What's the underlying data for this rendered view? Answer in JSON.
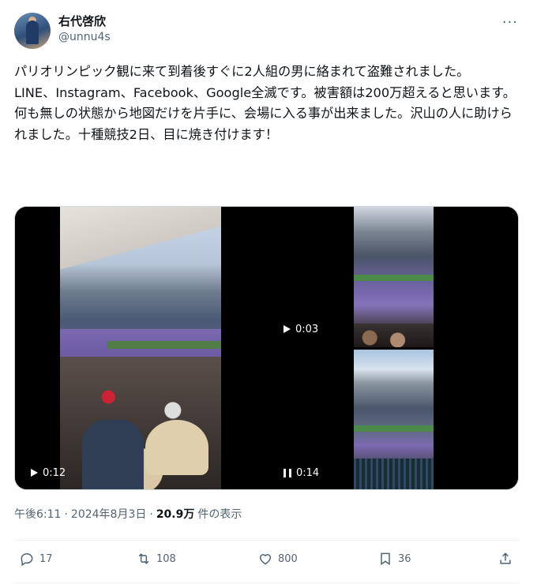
{
  "author": {
    "display_name": "右代啓欣",
    "handle": "@unnu4s"
  },
  "tweet": {
    "text": "パリオリンピック観に来て到着後すぐに2人組の男に絡まれて盗難されました。\nLINE、Instagram、Facebook、Google全滅です。被害額は200万超えると思います。\n何も無しの状態から地図だけを片手に、会場に入る事が出来ました。沢山の人に助けられました。十種競技2日、目に焼き付けます！"
  },
  "media": [
    {
      "kind": "video",
      "control_icon": "play-icon",
      "duration": "0:12"
    },
    {
      "kind": "video",
      "control_icon": "play-icon",
      "duration": "0:03"
    },
    {
      "kind": "video",
      "control_icon": "pause-icon",
      "duration": "0:14"
    }
  ],
  "meta": {
    "time": "午後6:11",
    "separator": "·",
    "date": "2024年8月3日",
    "views_count": "20.9万",
    "views_label": "件の表示"
  },
  "actions": {
    "reply_count": "17",
    "repost_count": "108",
    "like_count": "800",
    "bookmark_count": "36"
  },
  "icons": {
    "more": "more-icon",
    "reply": "reply-icon",
    "repost": "repost-icon",
    "like": "heart-icon",
    "bookmark": "bookmark-icon",
    "share": "share-icon"
  },
  "colors": {
    "text_primary": "#0f1419",
    "text_secondary": "#536471",
    "border": "#eff3f4"
  }
}
